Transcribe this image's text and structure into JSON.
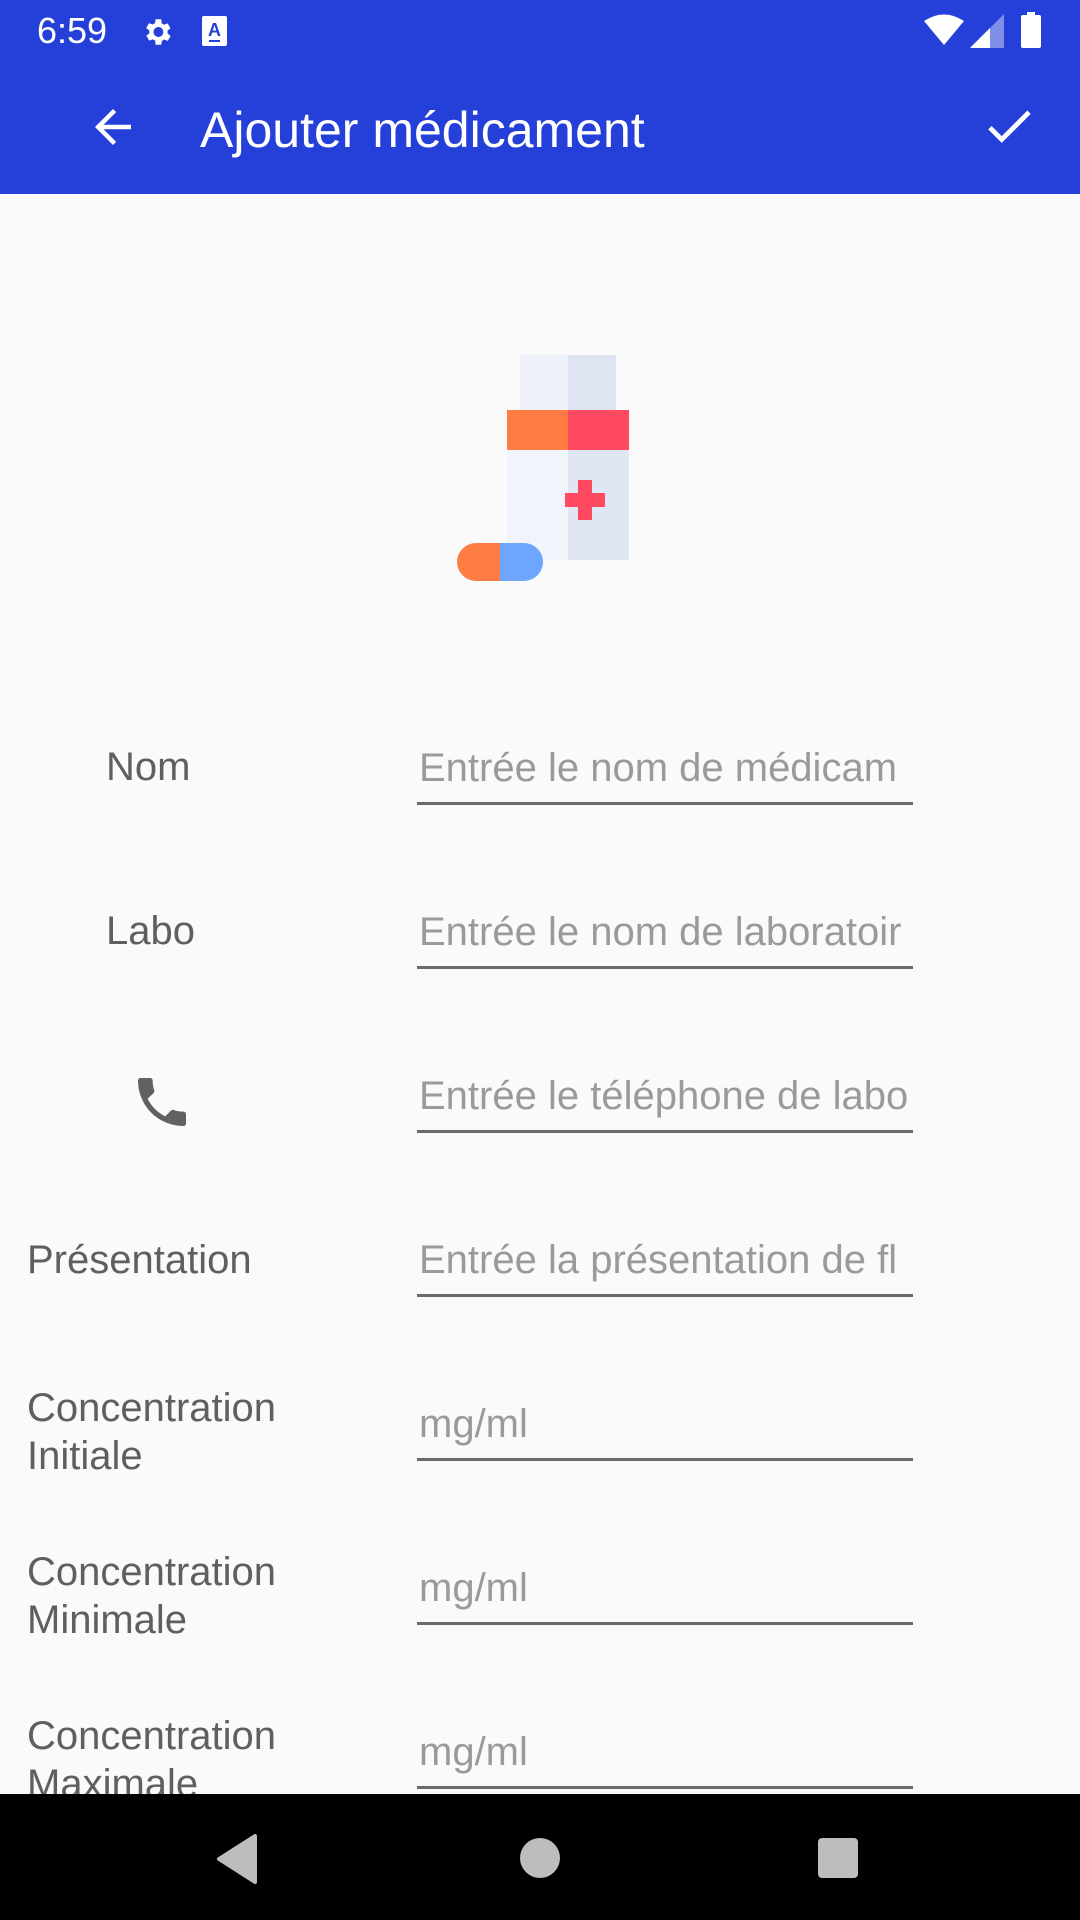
{
  "status_bar": {
    "time": "6:59",
    "icons": [
      "settings-icon",
      "text-a-icon",
      "wifi-icon",
      "signal-icon",
      "battery-icon"
    ]
  },
  "toolbar": {
    "title": "Ajouter médicament",
    "back_icon": "arrow-left-icon",
    "confirm_icon": "check-icon",
    "background": "#2440d8"
  },
  "illustration": {
    "icon": "medicine-bottle-icon"
  },
  "form": {
    "nom": {
      "label": "Nom",
      "placeholder": "Entrée le nom de médicam",
      "value": ""
    },
    "labo": {
      "label": "Labo",
      "placeholder": "Entrée le nom de laboratoir",
      "value": ""
    },
    "telephone": {
      "icon": "phone-icon",
      "placeholder": "Entrée le téléphone de labo",
      "value": ""
    },
    "presentation": {
      "label": "Présentation",
      "placeholder": "Entrée la présentation de fl",
      "value": ""
    },
    "concentration_initiale": {
      "label_line1": "Concentration",
      "label_line2": "Initiale",
      "placeholder": "mg/ml",
      "value": ""
    },
    "concentration_minimale": {
      "label_line1": "Concentration",
      "label_line2": "Minimale",
      "placeholder": "mg/ml",
      "value": ""
    },
    "concentration_maximale": {
      "label_line1": "Concentration",
      "label_line2": "Maximale",
      "placeholder": "mg/ml",
      "value": ""
    }
  },
  "nav_bar": {
    "icons": [
      "nav-back-icon",
      "nav-home-icon",
      "nav-recents-icon"
    ]
  }
}
